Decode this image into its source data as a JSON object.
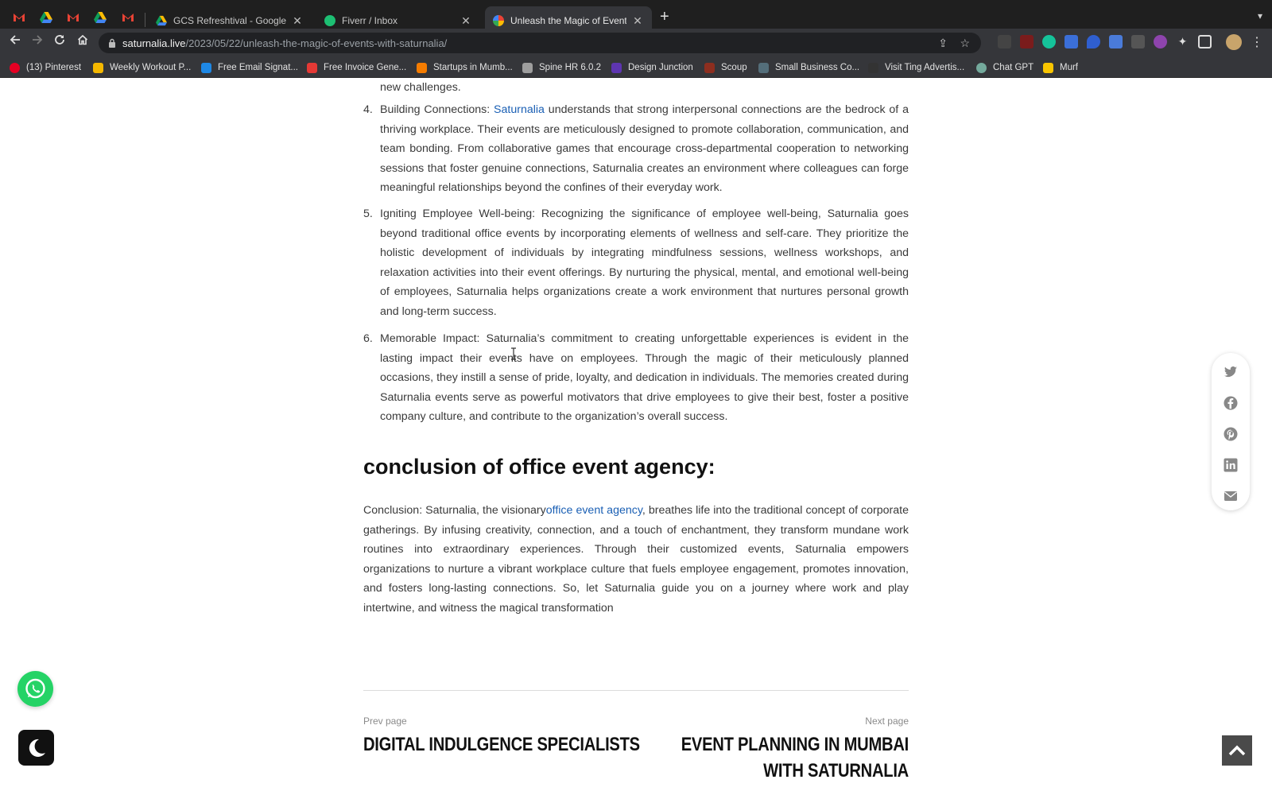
{
  "browser": {
    "tabs": [
      {
        "title": "GCS Refreshtival - Google Driv",
        "favicon": "google-drive-icon",
        "active": false
      },
      {
        "title": "Fiverr / Inbox",
        "favicon": "fiverr-icon",
        "active": false
      },
      {
        "title": "Unleash the Magic of Events w",
        "favicon": "saturnalia-icon",
        "active": true
      }
    ],
    "pinned_tabs": [
      "gmail-icon",
      "google-drive-icon",
      "gmail-icon",
      "google-drive-icon",
      "gmail-icon"
    ],
    "url_host": "saturnalia.live",
    "url_path": "/2023/05/22/unleash-the-magic-of-events-with-saturnalia/",
    "bookmarks": [
      {
        "label": "(13) Pinterest",
        "color": "#e60023"
      },
      {
        "label": "Weekly Workout P...",
        "color": "#f5b800"
      },
      {
        "label": "Free Email Signat...",
        "color": "#1e88e5"
      },
      {
        "label": "Free Invoice Gene...",
        "color": "#e53935"
      },
      {
        "label": "Startups in Mumb...",
        "color": "#f57c00"
      },
      {
        "label": "Spine HR 6.0.2",
        "color": "#9e9e9e"
      },
      {
        "label": "Design Junction",
        "color": "#5e35b1"
      },
      {
        "label": "Scoup",
        "color": "#8d2e1f"
      },
      {
        "label": "Small Business Co...",
        "color": "#546e7a"
      },
      {
        "label": "Visit Ting Advertis...",
        "color": "#333333"
      },
      {
        "label": "Chat GPT",
        "color": "#74aa9c"
      },
      {
        "label": "Murf",
        "color": "#f9c500"
      }
    ]
  },
  "article": {
    "partial_line": "new challenges.",
    "items": [
      {
        "num": "4.",
        "pre": "Building Connections: ",
        "link": "Saturnalia",
        "post": " understands that strong interpersonal connections are the bedrock of a thriving workplace. Their events are meticulously designed to promote collaboration, communication, and team bonding. From collaborative games that encourage cross-departmental cooperation to networking sessions that foster genuine connections, Saturnalia creates an environment where colleagues can forge meaningful relationships beyond the confines of their everyday work."
      },
      {
        "num": "5.",
        "text": "Igniting Employee Well-being: Recognizing the significance of employee well-being, Saturnalia goes beyond traditional office events by incorporating elements of wellness and self-care. They prioritize the holistic development of individuals by integrating mindfulness sessions, wellness workshops, and relaxation activities into their event offerings. By nurturing the physical, mental, and emotional well-being of employees, Saturnalia helps organizations create a work environment that nurtures personal growth and long-term success."
      },
      {
        "num": "6.",
        "text": "Memorable Impact: Saturnalia’s commitment to creating unforgettable experiences is evident in the lasting impact their events have on employees. Through the magic of their meticulously planned occasions, they instill a sense of pride, loyalty, and dedication in individuals. The memories created during Saturnalia events serve as powerful motivators that drive employees to give their best, foster a positive company culture, and contribute to the organization’s overall success."
      }
    ],
    "heading": "conclusion of office event agency:",
    "conclusion": {
      "pre": "Conclusion: Saturnalia, the visionary",
      "link": "office event agency",
      "post": ", breathes life into the traditional concept of corporate gatherings. By infusing creativity, connection, and a touch of enchantment, they transform mundane work routines into extraordinary experiences. Through their customized events, Saturnalia empowers organizations to nurture a vibrant workplace culture that fuels employee engagement, promotes innovation, and fosters long-lasting connections. So, let Saturnalia guide you on a journey where work and play intertwine, and witness the magical transformation"
    }
  },
  "pager": {
    "prev_label": "Prev page",
    "prev_title": "DIGITAL INDULGENCE SPECIALISTS",
    "next_label": "Next page",
    "next_title": "EVENT PLANNING IN MUMBAI WITH SATURNALIA"
  },
  "share": [
    "twitter-icon",
    "facebook-icon",
    "pinterest-icon",
    "linkedin-icon",
    "email-icon"
  ],
  "colors": {
    "link": "#1a5fb4",
    "whatsapp": "#25d366",
    "chrome_dark": "#35363a"
  }
}
